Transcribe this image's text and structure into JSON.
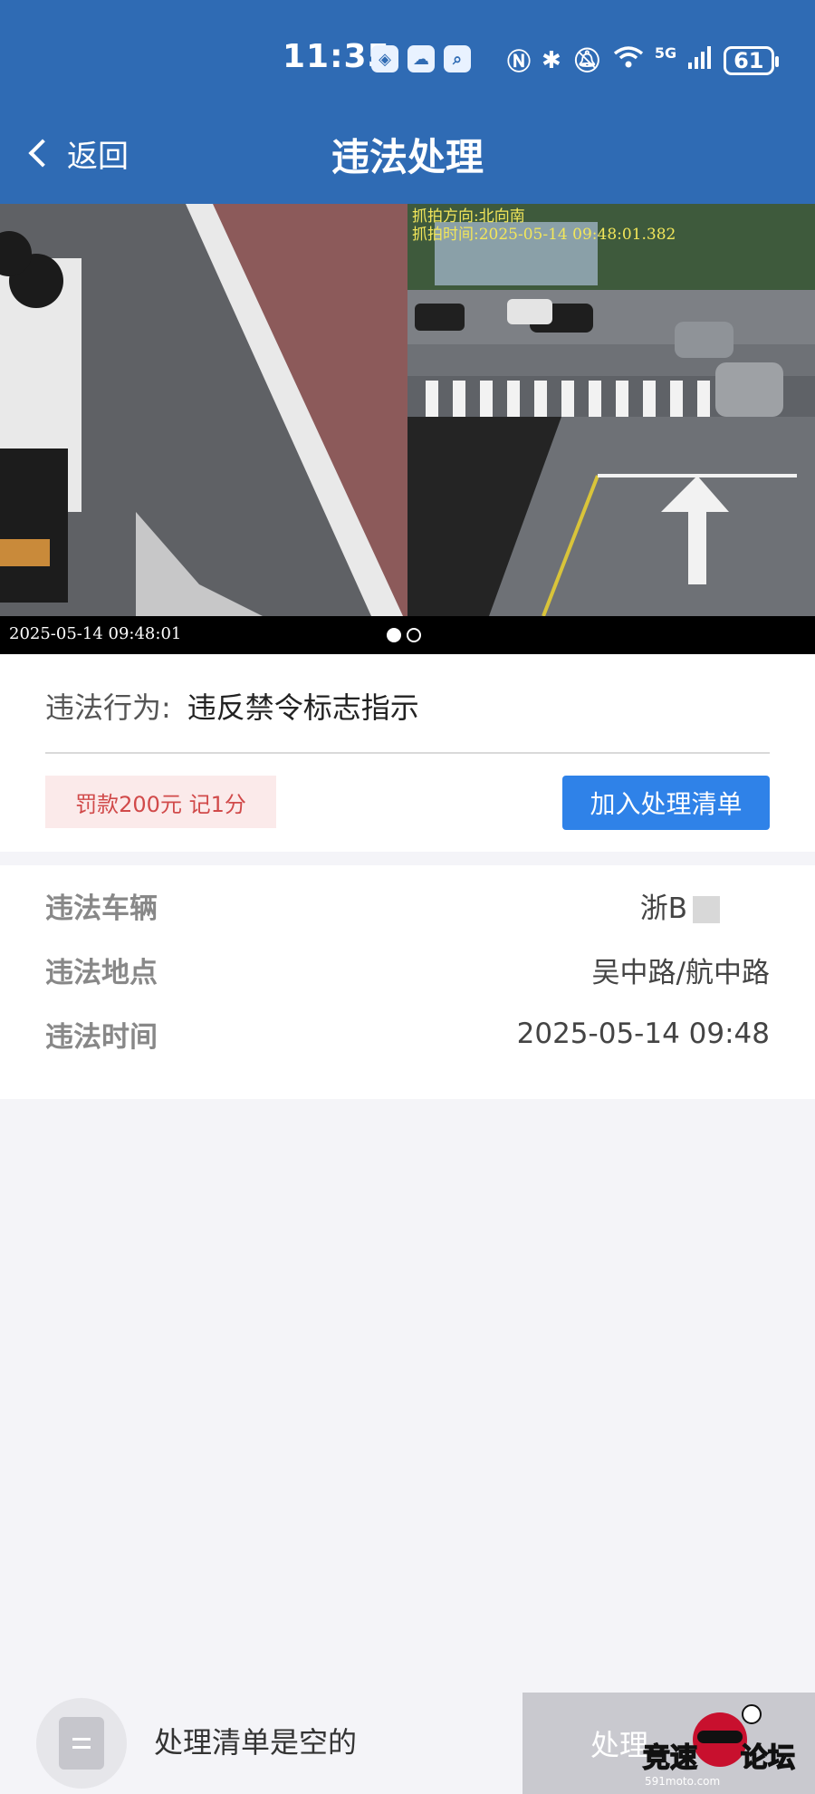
{
  "status_bar": {
    "time": "11:35",
    "network": "5G",
    "battery": "61",
    "app_icons": [
      "cube-app-icon",
      "weather-app-icon",
      "search-app-icon"
    ],
    "system_icons": [
      "nfc-icon",
      "bluetooth-icon",
      "mute-icon",
      "wifi-icon",
      "signal-icon",
      "battery-icon"
    ]
  },
  "nav": {
    "back_label": "返回",
    "title": "违法处理"
  },
  "photo": {
    "timestamp": "2025-05-14 09:48:01",
    "overlay_line1": "抓拍方向:北向南",
    "overlay_line2": "抓拍时间:2025-05-14 09:48:01.382",
    "pages": 2,
    "active_page": 1
  },
  "violation": {
    "label": "违法行为:",
    "value": "违反禁令标志指示",
    "penalty": "罚款200元 记1分",
    "add_button": "加入处理清单"
  },
  "details": [
    {
      "label": "违法车辆",
      "value": "浙B"
    },
    {
      "label": "违法地点",
      "value": "吴中路/航中路"
    },
    {
      "label": "违法时间",
      "value": "2025-05-14 09:48"
    }
  ],
  "bottom": {
    "empty_text": "处理清单是空的",
    "process_button": "处理"
  },
  "watermark": {
    "text": "竞速论坛",
    "sub": "591moto.com"
  },
  "colors": {
    "header": "#2f6bb4",
    "primary_button": "#2f82e8",
    "fine_text": "#d14a4a",
    "fine_bg": "#fbeaea"
  }
}
